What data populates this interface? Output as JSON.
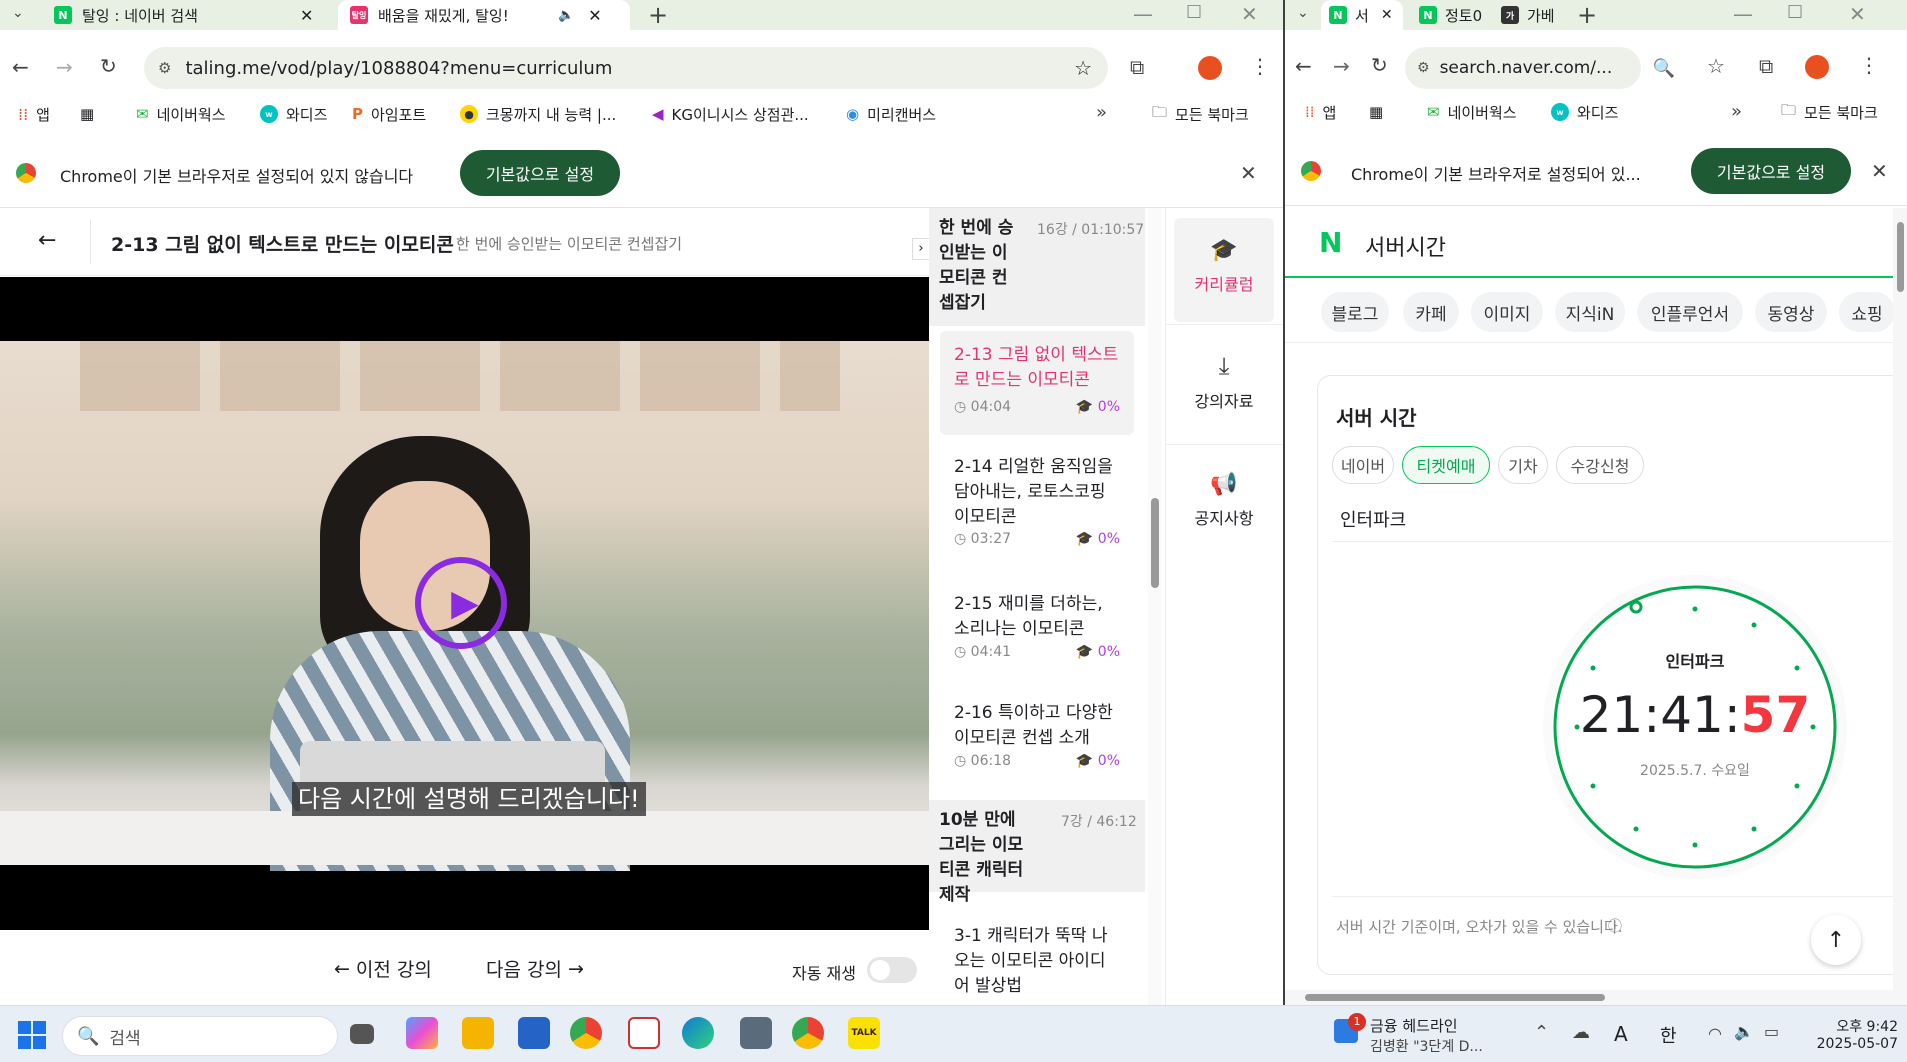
{
  "left_browser": {
    "tabs": [
      {
        "title": "탈잉 : 네이버 검색",
        "favicon": "N"
      },
      {
        "title": "배움을 재밌게, 탈잉!",
        "favicon": "탈잉"
      }
    ],
    "url": "taling.me/vod/play/1088804?menu=curriculum",
    "bookmarks": [
      "앱",
      "네이버웍스",
      "와디즈",
      "아임포트",
      "크몽까지 내 능력 |...",
      "KG이니시스 상점관...",
      "미리캔버스"
    ],
    "all_bookmarks": "모든 북마크",
    "infobar_text": "Chrome이 기본 브라우저로 설정되어 있지 않습니다",
    "infobar_button": "기본값으로 설정"
  },
  "player": {
    "lesson_title": "2-13 그림 없이 텍스트로 만드는 이모티콘",
    "course_subtitle": "한 번에 승인받는 이모티콘 컨셉잡기",
    "subtitle_caption": "다음 시간에 설명해 드리겠습니다!",
    "prev_label": "이전 강의",
    "next_label": "다음 강의",
    "autoplay_label": "자동 재생"
  },
  "curriculum": {
    "section1": {
      "title": "한 번에 승인받는 이모티콘 컨셉잡기",
      "count": "16강 / 01:10:57"
    },
    "lessons": [
      {
        "title": "2-13 그림 없이 텍스트로 만드는 이모티콘",
        "time": "04:04",
        "progress": "0%",
        "active": true
      },
      {
        "title": "2-14 리얼한 움직임을 담아내는, 로토스코핑 이모티콘",
        "time": "03:27",
        "progress": "0%"
      },
      {
        "title": "2-15 재미를 더하는, 소리나는 이모티콘",
        "time": "04:41",
        "progress": "0%"
      },
      {
        "title": "2-16 특이하고 다양한 이모티콘 컨셉 소개",
        "time": "06:18",
        "progress": "0%"
      }
    ],
    "section2": {
      "title": "10분 만에 그리는 이모티콘 캐릭터 제작",
      "count": "7강 / 46:12"
    },
    "next_lesson": "3-1 캐릭터가 뚝딱 나오는 이모티콘 아이디어 발상법"
  },
  "side_menu": [
    {
      "label": "커리큘럼",
      "icon": "graduation-cap-icon"
    },
    {
      "label": "강의자료",
      "icon": "download-icon"
    },
    {
      "label": "공지사항",
      "icon": "megaphone-icon"
    }
  ],
  "right_browser": {
    "tabs": [
      {
        "title": "서",
        "favicon": "N"
      },
      {
        "title": "정토0",
        "favicon": "N"
      },
      {
        "title": "가베",
        "favicon": "가"
      }
    ],
    "url": "search.naver.com/...",
    "bookmarks": [
      "앱",
      "네이버웍스",
      "와디즈"
    ],
    "all_bookmarks": "모든 북마크",
    "infobar_text": "Chrome이 기본 브라우저로 설정되어 있...",
    "infobar_button": "기본값으로 설정"
  },
  "naver": {
    "search_query": "서버시간",
    "categories": [
      "블로그",
      "카페",
      "이미지",
      "지식iN",
      "인플루언서",
      "동영상",
      "쇼핑"
    ],
    "card_title": "서버 시간",
    "site_tabs": [
      "네이버",
      "티켓예매",
      "기차",
      "수강신청"
    ],
    "selected_site": "인터파크",
    "clock_label": "인터파크",
    "time_hm": "21:41:",
    "time_s": "57",
    "date": "2025.5.7. 수요일",
    "note": "서버 시간 기준이며, 오차가 있을 수 있습니다."
  },
  "taskbar": {
    "search_placeholder": "검색",
    "news_title": "금융 헤드라인",
    "news_sub": "김병환 \"3단계 D...",
    "notification_count": "1",
    "ime1": "A",
    "ime2": "한",
    "time": "오후 9:42",
    "date": "2025-05-07"
  },
  "colors": {
    "accent": "#e5336f",
    "naver_green": "#03c75a",
    "chrome_green": "#1e5b35",
    "progress_purple": "#b23ee0"
  }
}
